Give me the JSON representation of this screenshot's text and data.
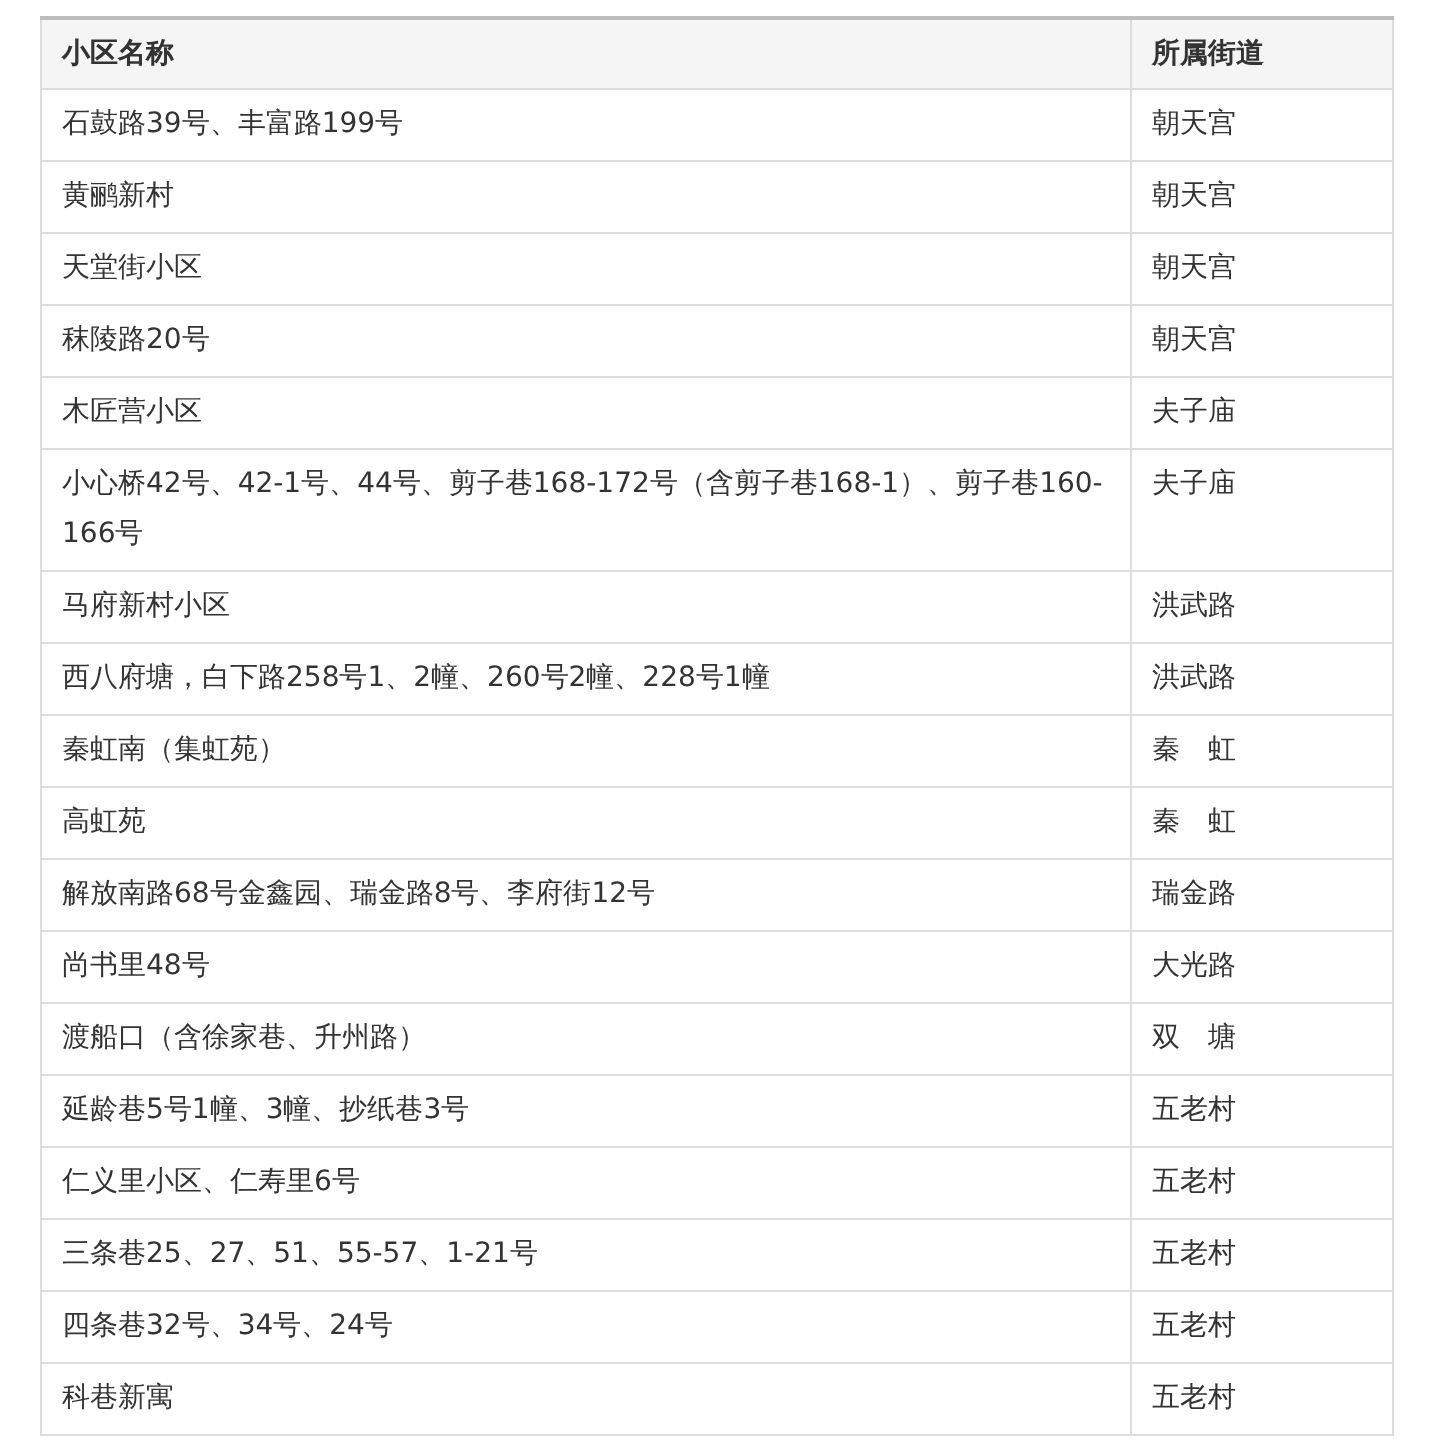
{
  "table": {
    "columns": [
      "小区名称",
      "所属街道"
    ],
    "rows": [
      [
        "石鼓路39号、丰富路199号",
        "朝天宫"
      ],
      [
        "黄鹂新村",
        "朝天宫"
      ],
      [
        "天堂街小区",
        "朝天宫"
      ],
      [
        "秣陵路20号",
        "朝天宫"
      ],
      [
        "木匠营小区",
        "夫子庙"
      ],
      [
        "小心桥42号、42-1号、44号、剪子巷168-172号（含剪子巷168-1）、剪子巷160-166号",
        "夫子庙"
      ],
      [
        "马府新村小区",
        "洪武路"
      ],
      [
        "西八府塘，白下路258号1、2幢、260号2幢、228号1幢",
        "洪武路"
      ],
      [
        "秦虹南（集虹苑）",
        "秦　虹"
      ],
      [
        "高虹苑",
        "秦　虹"
      ],
      [
        "解放南路68号金鑫园、瑞金路8号、李府街12号",
        "瑞金路"
      ],
      [
        "尚书里48号",
        "大光路"
      ],
      [
        "渡船口（含徐家巷、升州路）",
        "双　塘"
      ],
      [
        "延龄巷5号1幢、3幢、抄纸巷3号",
        "五老村"
      ],
      [
        "仁义里小区、仁寿里6号",
        "五老村"
      ],
      [
        "三条巷25、27、51、55-57、1-21号",
        "五老村"
      ],
      [
        "四条巷32号、34号、24号",
        "五老村"
      ],
      [
        "科巷新寓",
        "五老村"
      ]
    ]
  }
}
